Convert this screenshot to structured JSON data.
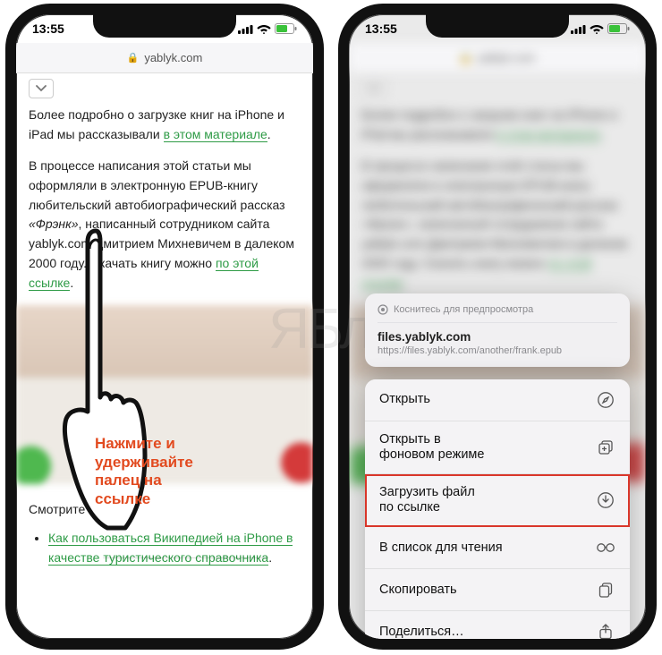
{
  "status": {
    "time": "13:55"
  },
  "urlbar": {
    "domain": "yablyk.com"
  },
  "article": {
    "p1a": "Более подробно о загрузке книг на iPhone и iPad мы рассказывали ",
    "p1_link": "в этом материале",
    "p1b": ".",
    "p2a": "В процессе написания этой статьи мы оформляли в электронную EPUB-книгу любительский автобиографический рассказ ",
    "p2_title": "«Фрэнк»",
    "p2b": ", написанный сотрудником сайта yablyk.com Дмитрием Михневичем в далеком 2000 году. Скачать книгу можно ",
    "p2_link": "по этой ссылке",
    "p2c": ".",
    "see_also": "Смотрите также:",
    "li1a": "Как пользоваться Википедией на iPhone в качестве ",
    "li1b": "туристического справочника",
    "li1c": "."
  },
  "callout": {
    "l1": "Нажмите и",
    "l2": "удерживайте",
    "l3": "палец на",
    "l4": "ссылке"
  },
  "context": {
    "preview_hint": "Коснитесь для предпросмотра",
    "preview_domain": "files.yablyk.com",
    "preview_url": "https://files.yablyk.com/another/frank.epub",
    "items": {
      "open": "Открыть",
      "open_bg_l1": "Открыть в",
      "open_bg_l2": "фоновом режиме",
      "download_l1": "Загрузить файл",
      "download_l2": "по ссылке",
      "reading_list": "В список для чтения",
      "copy": "Скопировать",
      "share": "Поделиться…"
    }
  },
  "watermark": "ЯБлык"
}
